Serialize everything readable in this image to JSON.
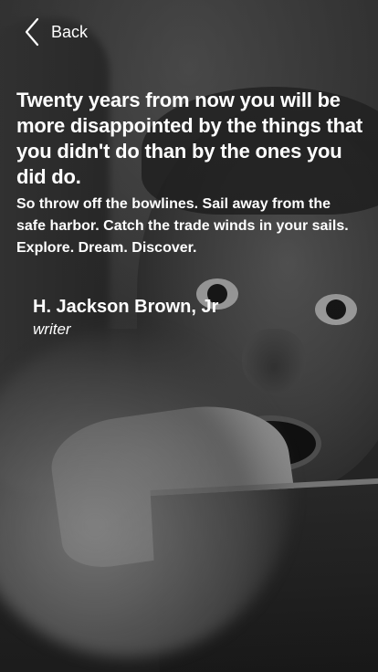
{
  "nav": {
    "back_label": "Back",
    "back_icon": "chevron-left-icon"
  },
  "quote": {
    "headline": "Twenty years from now you will be more disappointed by the things that you didn't do than by the ones you did do.",
    "body": "So throw off the bowlines. Sail away from the safe harbor. Catch the trade winds in your sails. Explore. Dream. Discover."
  },
  "author": {
    "name": "H. Jackson Brown, Jr",
    "role": "writer"
  },
  "colors": {
    "text": "#ffffff",
    "background": "#2a2a2a"
  }
}
